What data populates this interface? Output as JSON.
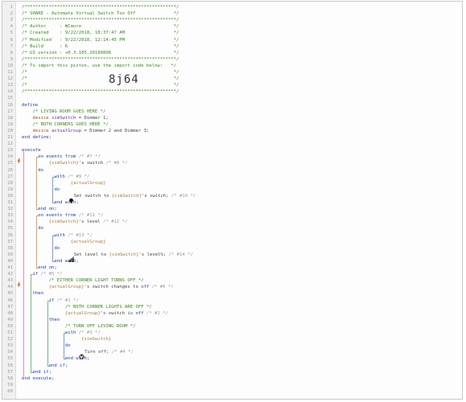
{
  "header": [
    "/********************************************************/",
    "/* SHARE - Automate Virtual Switch Too Off              */",
    "/********************************************************/",
    "/* Author     : WCmore                                  */",
    "/* Created    : 9/22/2018, 10:37:47 AM                  */",
    "/* Modified   : 9/22/2018, 12:14:45 PM                  */",
    "/* Build      : 6                                       */",
    "/* UI version : v0.3.105.20180806                       */",
    "/********************************************************/",
    "/* To import this piston, use the import code below:   */",
    "/*                                                      */",
    "/*                                                      */",
    "/*                                                      */",
    "/********************************************************/"
  ],
  "import_code": "8j64",
  "line_numbers": [
    "1",
    "2",
    "3",
    "4",
    "5",
    "6",
    "7",
    "8",
    "9",
    "10",
    "11",
    "12",
    "13",
    "14",
    "15",
    "16",
    "17",
    "18",
    "19",
    "20",
    "21",
    "22",
    "23",
    "24",
    "25",
    "26",
    "27",
    "28",
    "29",
    "30",
    "31",
    "32",
    "33",
    "34",
    "35",
    "36",
    "37",
    "38",
    "39",
    "40",
    "41",
    "42",
    "43",
    "44",
    "45",
    "46",
    "47",
    "48",
    "49",
    "50",
    "51",
    "52",
    "53",
    "54",
    "55",
    "56",
    "57",
    "58",
    "59",
    "60"
  ],
  "t": {
    "define": "define",
    "c_living": "/* LIVING ROOM GOES HERE */",
    "device": "device",
    "simSwitch": "simSwitch",
    "eq_dimmer1": " = Dimmer 1;",
    "c_corners": "/* BOTH CORNERS GOES HERE */",
    "actualGroup": "actualGroup",
    "eq_dimmer23": " = Dimmer 2 and Dimmer 3;",
    "end_define": "end define;",
    "execute": "execute",
    "on_events_from": "on events from",
    "id7": "/* #7 */",
    "ph_sim": "{simSwitch}",
    "s_switch": "'s switch",
    "id8": "/* #8 */",
    "do": "do",
    "with": "with",
    "id9": "/* #9 */",
    "ph_group": "{actualGroup}",
    "set_switch_to": "Set switch to",
    "s_switch_semi": "'s switch;",
    "id10": "/* #10 */",
    "end_with": "end with;",
    "end_on": "end on;",
    "id11": "/* #11 */",
    "s_level": "'s level",
    "id12": "/* #12 */",
    "id13": "/* #13 */",
    "set_level_to": "Set level to",
    "s_level_pct": "'s level%;",
    "id14": "/* #14 */",
    "if": "if",
    "id5": "/* #5 */",
    "c_either": "/* EITHER CORNER LIGHT TURNS OFF */",
    "s_switch_changes": "'s switch changes to",
    "off": "off",
    "id6": "/* #6 */",
    "then": "then",
    "id1": "/* #1 */",
    "c_both_off": "/* BOTH CORNER LIGHTS ARE OFF */",
    "s_switch_is": "'s switch is",
    "id2": "/* #2 */",
    "c_turnoff": "/* TURN OFF LIVING ROOM */",
    "id3": "/* #3 */",
    "turn_off": "Turn off;",
    "id4": "/* #4 */",
    "end_if": "end if;",
    "end_execute": "end execute;"
  },
  "colors": {
    "comment": "#3a8a1e",
    "keyword": "#1a3dbb",
    "variable": "#6d2fa3",
    "placeholder": "#b07a3f"
  },
  "icons": [
    "switch-bulb-icon",
    "level-bars-icon",
    "power-icon",
    "event-trigger-icon"
  ]
}
